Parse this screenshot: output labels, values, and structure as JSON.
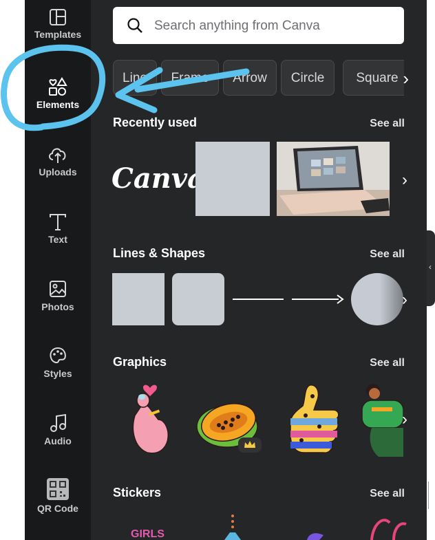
{
  "rail": {
    "items": [
      {
        "label": "Templates",
        "icon": "templates-icon"
      },
      {
        "label": "Elements",
        "icon": "elements-icon"
      },
      {
        "label": "Uploads",
        "icon": "upload-cloud-icon"
      },
      {
        "label": "Text",
        "icon": "text-icon"
      },
      {
        "label": "Photos",
        "icon": "photos-icon"
      },
      {
        "label": "Styles",
        "icon": "palette-icon"
      },
      {
        "label": "Audio",
        "icon": "music-note-icon"
      },
      {
        "label": "QR Code",
        "icon": "qr-code-icon"
      }
    ],
    "active": "Elements"
  },
  "search": {
    "placeholder": "Search anything from Canva"
  },
  "chips": [
    "Line",
    "Frame",
    "Arrow",
    "Circle",
    "Square"
  ],
  "sections": {
    "recent": {
      "title": "Recently used",
      "see_all": "See all",
      "canva_text": "Canva"
    },
    "lines": {
      "title": "Lines & Shapes",
      "see_all": "See all"
    },
    "graphics": {
      "title": "Graphics",
      "see_all": "See all"
    },
    "stickers": {
      "title": "Stickers",
      "see_all": "See all",
      "sticker_text": "GIRLS"
    }
  },
  "colors": {
    "rail": "#18191b",
    "panel": "#252627",
    "annotation": "#5bc3ee"
  }
}
